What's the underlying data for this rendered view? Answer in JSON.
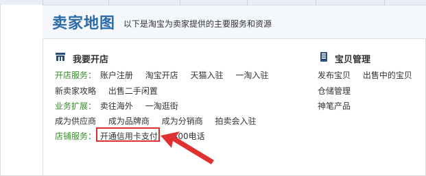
{
  "header": {
    "title": "卖家地图",
    "subtitle": "以下是淘宝为卖家提供的主要服务和资源"
  },
  "left_section": {
    "title": "我要开店",
    "icon": "shop-icon",
    "rows": [
      {
        "label": "开店服务：",
        "links": [
          "账户注册",
          "淘宝开店",
          "天猫入驻",
          "一淘入驻"
        ]
      },
      {
        "label": "",
        "links": [
          "新卖家攻略",
          "出售二手闲置"
        ]
      },
      {
        "label": "业务扩展：",
        "links": [
          "卖往海外",
          "一淘逛街"
        ]
      },
      {
        "label": "",
        "links": [
          "成为供应商",
          "成为品牌商",
          "成为分销商",
          "拍卖会入驻"
        ]
      },
      {
        "label": "店铺服务：",
        "links": [
          "开通信用卡支付",
          "400电话"
        ]
      }
    ]
  },
  "right_section": {
    "title": "宝贝管理",
    "icon": "item-icon",
    "rows": [
      {
        "links": [
          "发布宝贝",
          "出售中的宝贝"
        ]
      },
      {
        "links": [
          "仓储管理"
        ]
      },
      {
        "links": [
          "神笔产品"
        ]
      }
    ]
  },
  "colors": {
    "title_blue": "#2a6aa8",
    "label_green": "#3a8a2e",
    "highlight_red": "#e03030"
  }
}
